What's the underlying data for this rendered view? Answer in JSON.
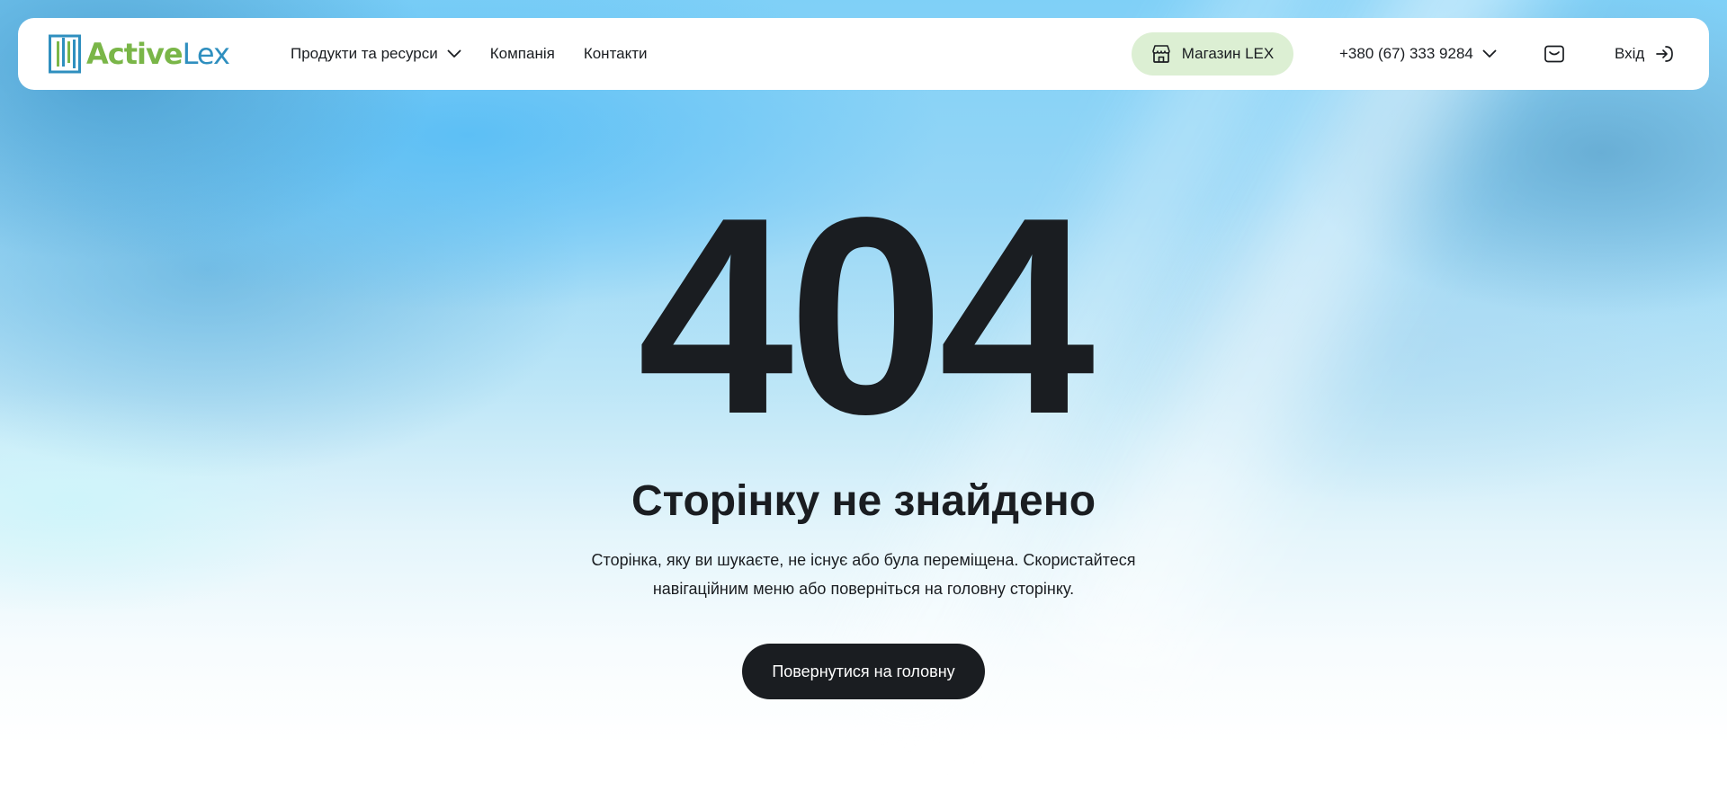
{
  "brand": {
    "name_part1": "Active",
    "name_part2": "Lex",
    "colors": {
      "green": "#7ab648",
      "blue": "#2f8fbf"
    }
  },
  "header": {
    "nav": [
      {
        "label": "Продукти та ресурси",
        "has_dropdown": true
      },
      {
        "label": "Компанія",
        "has_dropdown": false
      },
      {
        "label": "Контакти",
        "has_dropdown": false
      }
    ],
    "store_label": "Магазин LEX",
    "store_icon": "store-icon",
    "phone": "+380 (67) 333 9284",
    "mail_icon": "mail-icon",
    "login_label": "Вхід",
    "login_icon": "login-arrow-icon"
  },
  "main": {
    "code": "404",
    "title": "Сторінку не знайдено",
    "description": "Сторінка, яку ви шукаєте, не існує або була переміщена. Скористайтеся навігаційним меню або поверніться на головну сторінку.",
    "button_label": "Повернутися на головну"
  },
  "colors": {
    "text": "#1a1d21",
    "store_bg": "#dcefd3",
    "button_bg": "#1a1d21",
    "button_text": "#ffffff",
    "sky": "#7fd0f7"
  }
}
